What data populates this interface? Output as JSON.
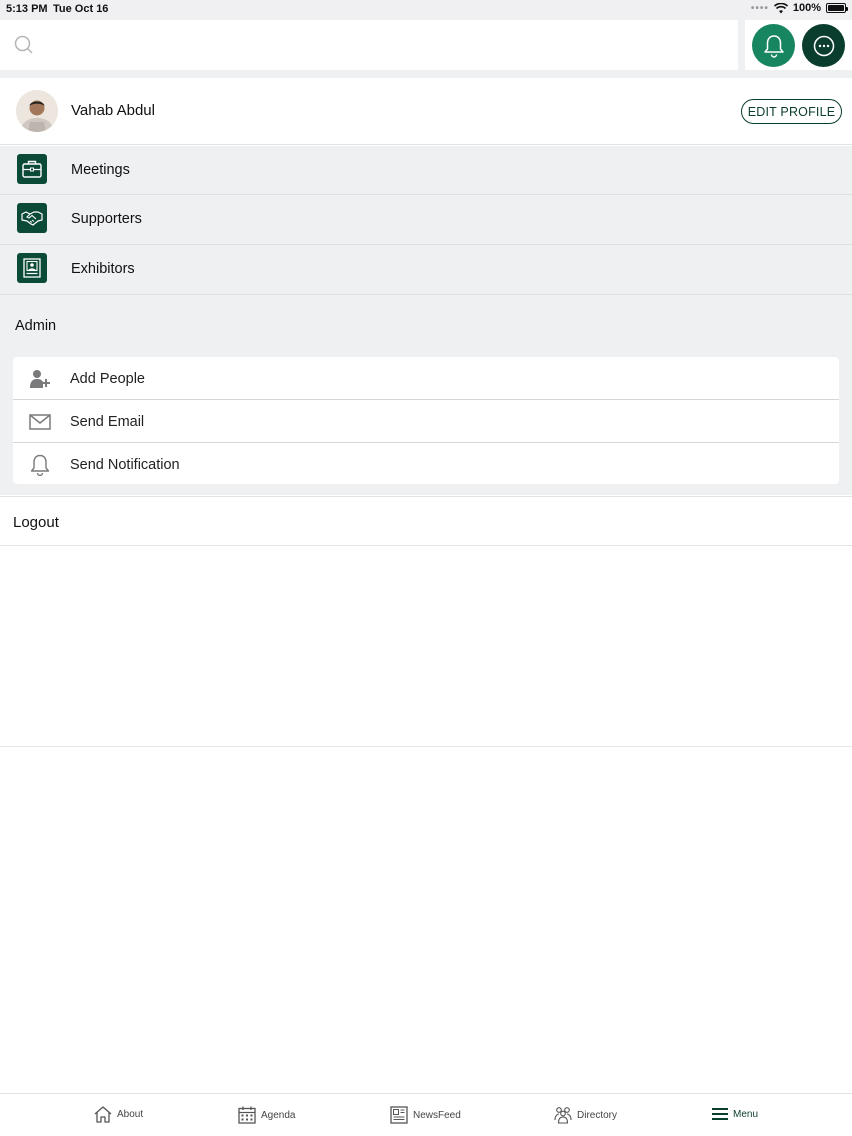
{
  "status_bar": {
    "time": "5:13 PM",
    "date": "Tue Oct 16",
    "battery": "100%"
  },
  "search": {
    "value": "",
    "placeholder": ""
  },
  "header_icons": {
    "notifications": "bell-icon",
    "messages": "chat-icon"
  },
  "profile": {
    "name": "Vahab Abdul",
    "edit_label": "EDIT PROFILE"
  },
  "menu": {
    "items": [
      {
        "label": "Meetings",
        "icon": "briefcase-icon"
      },
      {
        "label": "Supporters",
        "icon": "handshake-icon"
      },
      {
        "label": "Exhibitors",
        "icon": "exhibitor-icon"
      }
    ]
  },
  "admin": {
    "title": "Admin",
    "items": [
      {
        "label": "Add People",
        "icon": "add-person-icon"
      },
      {
        "label": "Send Email",
        "icon": "envelope-icon"
      },
      {
        "label": "Send Notification",
        "icon": "bell-outline-icon"
      }
    ]
  },
  "logout": {
    "label": "Logout"
  },
  "tabbar": {
    "tabs": [
      {
        "label": "About",
        "icon": "home-icon"
      },
      {
        "label": "Agenda",
        "icon": "calendar-icon"
      },
      {
        "label": "NewsFeed",
        "icon": "newspaper-icon"
      },
      {
        "label": "Directory",
        "icon": "people-icon"
      },
      {
        "label": "Menu",
        "icon": "hamburger-icon",
        "active": true
      }
    ]
  },
  "colors": {
    "brand_dark": "#0b3d2e",
    "brand_green": "#17855f",
    "background_gray": "#eff0f2"
  }
}
